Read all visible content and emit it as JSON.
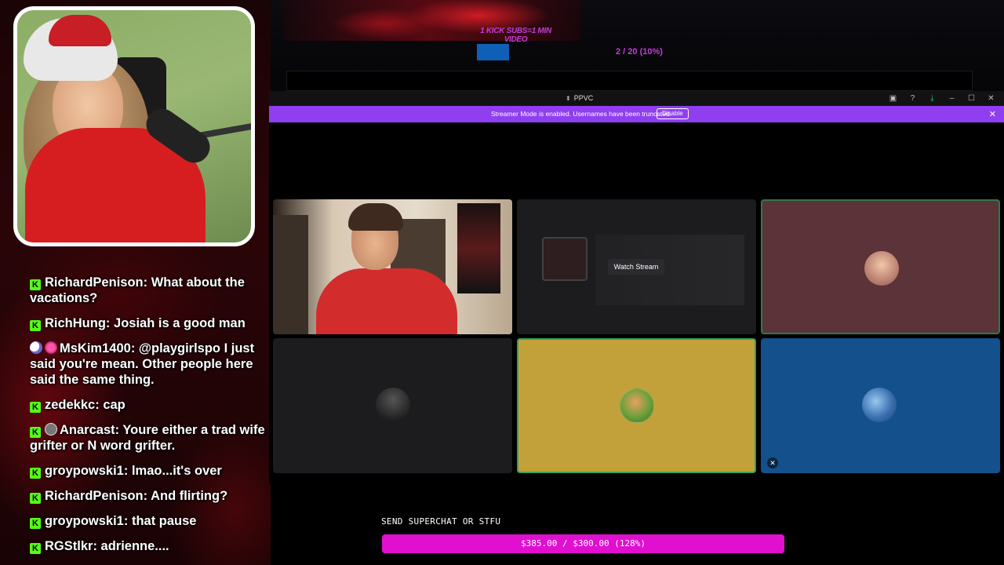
{
  "overlay": {
    "top_goal": {
      "title": "1 KICK SUBS=1 MIN VIDEO",
      "progress_text": "2 / 20 (10%)",
      "progress_fraction": 0.1
    },
    "bottom_goal": {
      "label": "SEND SUPERCHAT OR STFU",
      "progress_text": "$385.00 / $300.00 (128%)"
    }
  },
  "chat": [
    {
      "badge": "kick",
      "user": "RichardPenison",
      "text": "What about the vacations?"
    },
    {
      "badge": "kick",
      "user": "RichHung",
      "text": "Josiah is a good man"
    },
    {
      "badge": "moon+heart",
      "user": "MsKim1400",
      "text": "@playgirlspo I just said you're mean. Other people here said the same thing."
    },
    {
      "badge": "kick",
      "user": "zedekkc",
      "text": "cap"
    },
    {
      "badge": "kick+avatar",
      "user": "Anarcast",
      "text": "Youre either a trad wife grifter or N word grifter."
    },
    {
      "badge": "kick",
      "user": "groypowski1",
      "text": "lmao...it's over"
    },
    {
      "badge": "kick",
      "user": "RichardPenison",
      "text": "And flirting?"
    },
    {
      "badge": "kick",
      "user": "groypowski1",
      "text": "that pause"
    },
    {
      "badge": "kick",
      "user": "RGStlkr",
      "text": "adrienne...."
    }
  ],
  "window": {
    "title": "PPVC",
    "banner": {
      "text": "Streamer Mode is enabled. Usernames have been truncated.",
      "button": "Disable"
    },
    "tiles": [
      {
        "type": "video",
        "color": "#3d2b20"
      },
      {
        "type": "stream",
        "button": "Watch Stream",
        "color": "#1c1c1e"
      },
      {
        "type": "avatar",
        "color": "#5b3338",
        "speaking": true
      },
      {
        "type": "avatar",
        "color": "#1c1c1e"
      },
      {
        "type": "avatar",
        "color": "#c3a13a",
        "speaking": true
      },
      {
        "type": "avatar",
        "color": "#14508c",
        "muted": true
      }
    ]
  },
  "colors": {
    "kick_green": "#53fc18",
    "goal_purple": "#c43cdc",
    "banner_purple": "#8f3ff0",
    "superchat_pink": "#e10fd0"
  }
}
